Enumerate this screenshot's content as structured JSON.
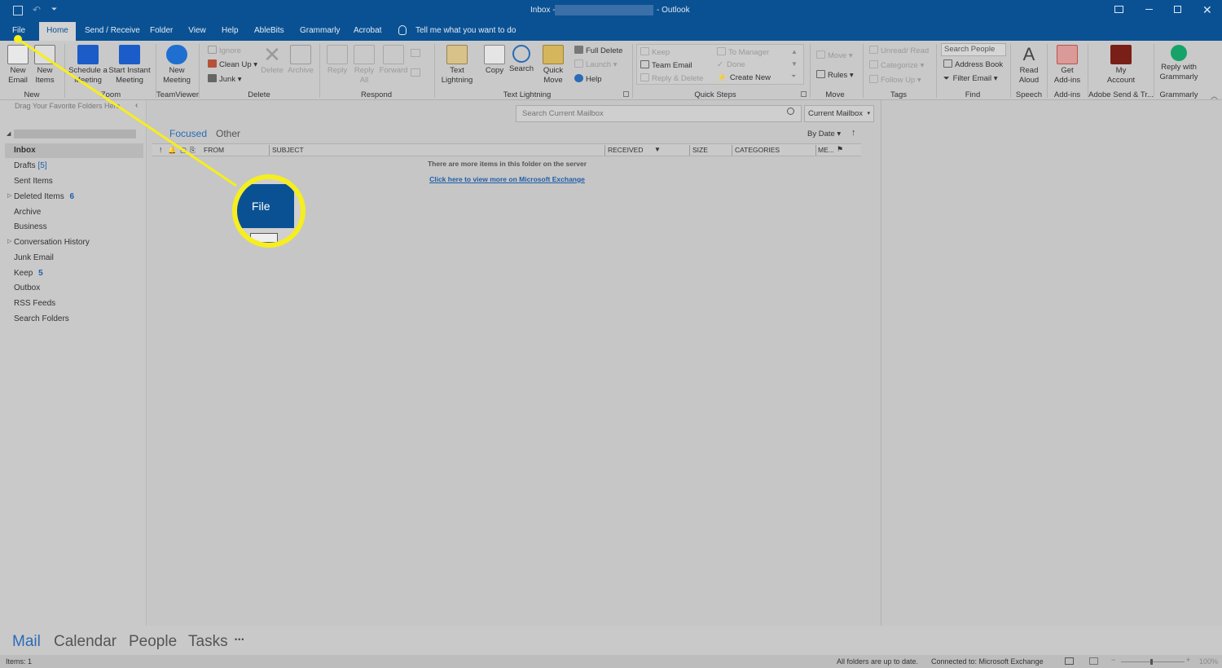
{
  "titlebar": {
    "prefix": "Inbox -",
    "suffix": "- Outlook"
  },
  "tabs": [
    "File",
    "Home",
    "Send / Receive",
    "Folder",
    "View",
    "Help",
    "AbleBits",
    "Grammarly",
    "Acrobat"
  ],
  "tell_me": "Tell me what you want to do",
  "ribbon": {
    "new_email": [
      "New",
      "Email"
    ],
    "new_items": [
      "New",
      "Items"
    ],
    "schedule_meeting": [
      "Schedule a",
      "Meeting"
    ],
    "start_instant_meeting": [
      "Start Instant",
      "Meeting"
    ],
    "new_meeting": [
      "New",
      "Meeting"
    ],
    "ignore": "Ignore",
    "clean_up": "Clean Up",
    "junk": "Junk",
    "delete": "Delete",
    "archive": "Archive",
    "reply": "Reply",
    "reply_all": [
      "Reply",
      "All"
    ],
    "forward": "Forward",
    "text_lightning": [
      "Text",
      "Lightning"
    ],
    "copy": "Copy",
    "search": "Search",
    "quick_move": [
      "Quick",
      "Move"
    ],
    "full_delete": "Full Delete",
    "launch": "Launch",
    "help": "Help",
    "keep": "Keep",
    "team_email": "Team Email",
    "reply_delete": "Reply & Delete",
    "to_manager": "To Manager",
    "done": "Done",
    "create_new": "Create New",
    "move": "Move",
    "rules": "Rules",
    "unread_read": "Unread/ Read",
    "categorize": "Categorize",
    "follow_up": "Follow Up",
    "search_people": "Search People",
    "address_book": "Address Book",
    "filter_email": "Filter Email",
    "read_aloud": [
      "Read",
      "Aloud"
    ],
    "get_addins": [
      "Get",
      "Add-ins"
    ],
    "my_account": [
      "My",
      "Account"
    ],
    "reply_grammarly": [
      "Reply with",
      "Grammarly"
    ]
  },
  "groups": {
    "new": "New",
    "zoom": "Zoom",
    "teamviewer": "TeamViewer",
    "delete": "Delete",
    "respond": "Respond",
    "text_lightning": "Text Lightning",
    "quick_steps": "Quick Steps",
    "move": "Move",
    "tags": "Tags",
    "find": "Find",
    "speech": "Speech",
    "addins": "Add-ins",
    "adobe": "Adobe Send & Tr...",
    "grammarly": "Grammarly"
  },
  "nav": {
    "favorites_hint": "Drag Your Favorite Folders Here",
    "folders": [
      {
        "name": "Inbox",
        "count": ""
      },
      {
        "name": "Drafts",
        "count": "[5]"
      },
      {
        "name": "Sent Items",
        "count": ""
      },
      {
        "name": "Deleted Items",
        "count": "6"
      },
      {
        "name": "Archive",
        "count": ""
      },
      {
        "name": "Business",
        "count": ""
      },
      {
        "name": "Conversation History",
        "count": ""
      },
      {
        "name": "Junk Email",
        "count": ""
      },
      {
        "name": "Keep",
        "count": "5"
      },
      {
        "name": "Outbox",
        "count": ""
      },
      {
        "name": "RSS Feeds",
        "count": ""
      },
      {
        "name": "Search Folders",
        "count": ""
      }
    ]
  },
  "mail": {
    "search_placeholder": "Search Current Mailbox",
    "scope": "Current Mailbox",
    "focused": "Focused",
    "other": "Other",
    "sort": "By Date",
    "columns": [
      "FROM",
      "SUBJECT",
      "RECEIVED",
      "SIZE",
      "CATEGORIES",
      "ME..."
    ],
    "server_msg": "There are more items in this folder on the server",
    "exchange_link": "Click here to view more on Microsoft Exchange"
  },
  "callout_label": "File",
  "bottom_nav": [
    "Mail",
    "Calendar",
    "People",
    "Tasks"
  ],
  "more_dots": "•••",
  "status": {
    "items": "Items: 1",
    "up_to_date": "All folders are up to date.",
    "connected": "Connected to: Microsoft Exchange",
    "zoom": "100%"
  },
  "colors": {
    "brand": "#0a5193",
    "highlight": "#f6ee1f",
    "link": "#1f5fa8"
  }
}
